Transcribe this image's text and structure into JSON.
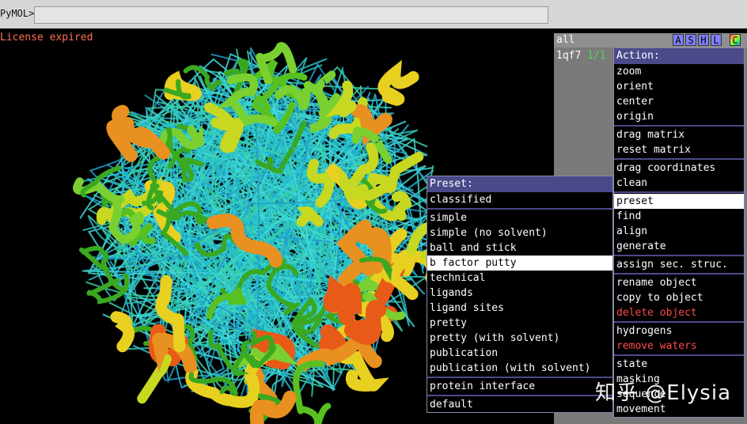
{
  "command_bar": {
    "prompt": "PyMOL>",
    "input_value": ""
  },
  "viewer": {
    "license_message": "License expired"
  },
  "object_panel": {
    "all_label": "all",
    "buttons": [
      "A",
      "S",
      "H",
      "L",
      "C"
    ],
    "objects": [
      {
        "name": "1qf7",
        "state": "1/1"
      }
    ]
  },
  "action_menu": {
    "title": "Action:",
    "groups": [
      [
        "zoom",
        "orient",
        "center",
        "origin"
      ],
      [
        "drag matrix",
        "reset matrix"
      ],
      [
        "drag coordinates",
        "clean"
      ],
      [
        "preset",
        "find",
        "align",
        "generate"
      ],
      [
        "assign sec. struc."
      ],
      [
        "rename object",
        "copy to object",
        "delete object"
      ],
      [
        "hydrogens",
        "remove waters"
      ],
      [
        "state",
        "masking",
        "sequence",
        "movement"
      ]
    ],
    "selected": "preset"
  },
  "preset_menu": {
    "title": "Preset:",
    "groups": [
      [
        "classified"
      ],
      [
        "simple",
        "simple (no solvent)",
        "ball and stick",
        "b factor putty",
        "technical",
        "ligands",
        "ligand sites",
        "pretty",
        "pretty (with solvent)",
        "publication",
        "publication (with solvent)"
      ],
      [
        "protein interface"
      ],
      [
        "default"
      ]
    ],
    "selected": "b factor putty"
  },
  "watermark": "知乎 @Elysia",
  "colors": {
    "menu_title": "#4a4a8a",
    "danger": "#ff4a4a",
    "license": "#ff7050"
  }
}
